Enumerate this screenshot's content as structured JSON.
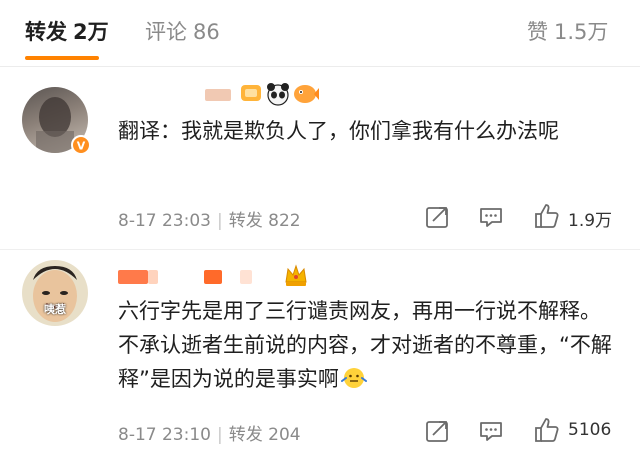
{
  "tabs": {
    "repost": {
      "label": "转发",
      "count": "2万"
    },
    "comments": {
      "label": "评论",
      "count": "86"
    },
    "likes": {
      "label": "赞",
      "count": "1.5万"
    }
  },
  "comments": [
    {
      "text": "翻译：我就是欺负人了，你们拿我有什么办法呢",
      "date": "8-17 23:03",
      "repost_label": "转发",
      "repost_count": "822",
      "like_count": "1.9万",
      "verified_badge": "V"
    },
    {
      "avatar_label": "咦惹",
      "text": "六行字先是用了三行谴责网友，再用一行说不解释。不承认逝者生前说的内容，才对逝者的不尊重，“不解释”是因为说的是事实啊",
      "date": "8-17 23:10",
      "repost_label": "转发",
      "repost_count": "204",
      "like_count": "5106"
    }
  ],
  "colors": {
    "accent": "#ff8200",
    "muted": "#8a8a8a"
  }
}
